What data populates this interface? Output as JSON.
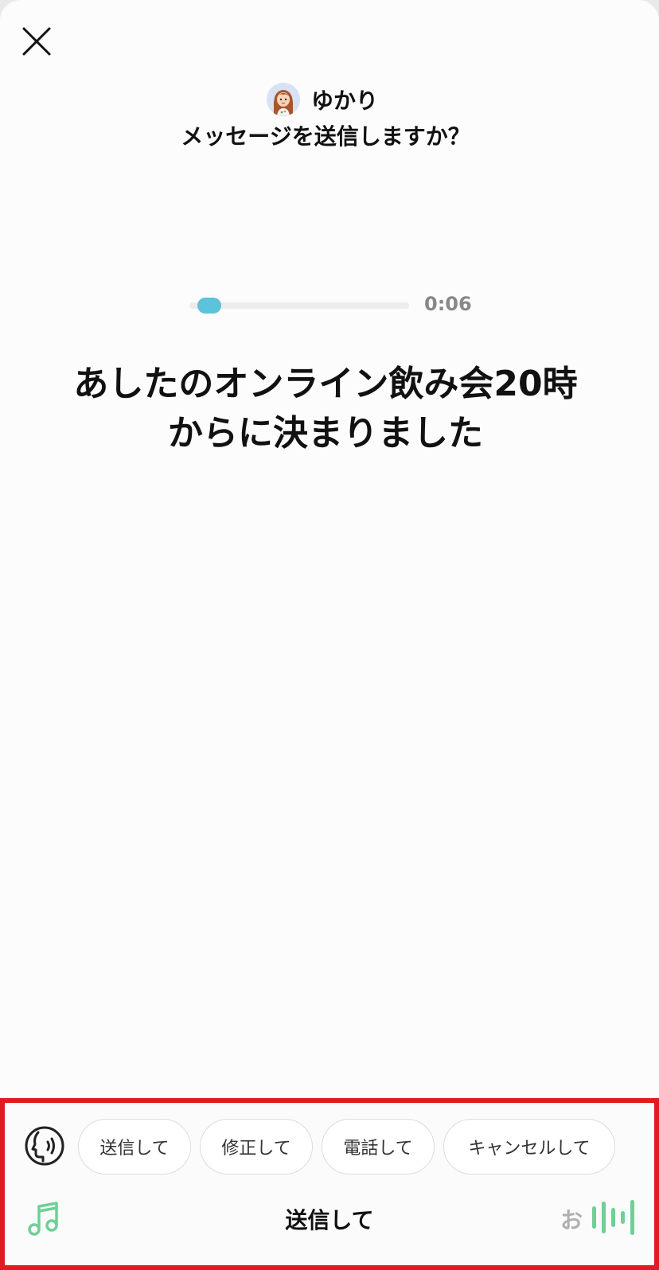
{
  "header": {
    "contact_name": "ゆかり",
    "prompt": "メッセージを送信しますか？"
  },
  "playback": {
    "elapsed": "0:06",
    "progress": 0.04
  },
  "transcript": {
    "line1": "あしたのオンライン飲み会20時",
    "line2": "からに決まりました"
  },
  "commands": {
    "chips": [
      "送信して",
      "修正して",
      "電話して",
      "キャンセルして"
    ],
    "current": "送信して",
    "ime_indicator": "お"
  },
  "icons": {
    "close": "close-icon",
    "voice": "speaking-head-icon",
    "music": "music-note-icon",
    "level": "audio-level-icon"
  },
  "colors": {
    "accent_green": "#6fcf97",
    "progress_blue": "#5cc3da",
    "highlight_red": "#e01b24"
  }
}
